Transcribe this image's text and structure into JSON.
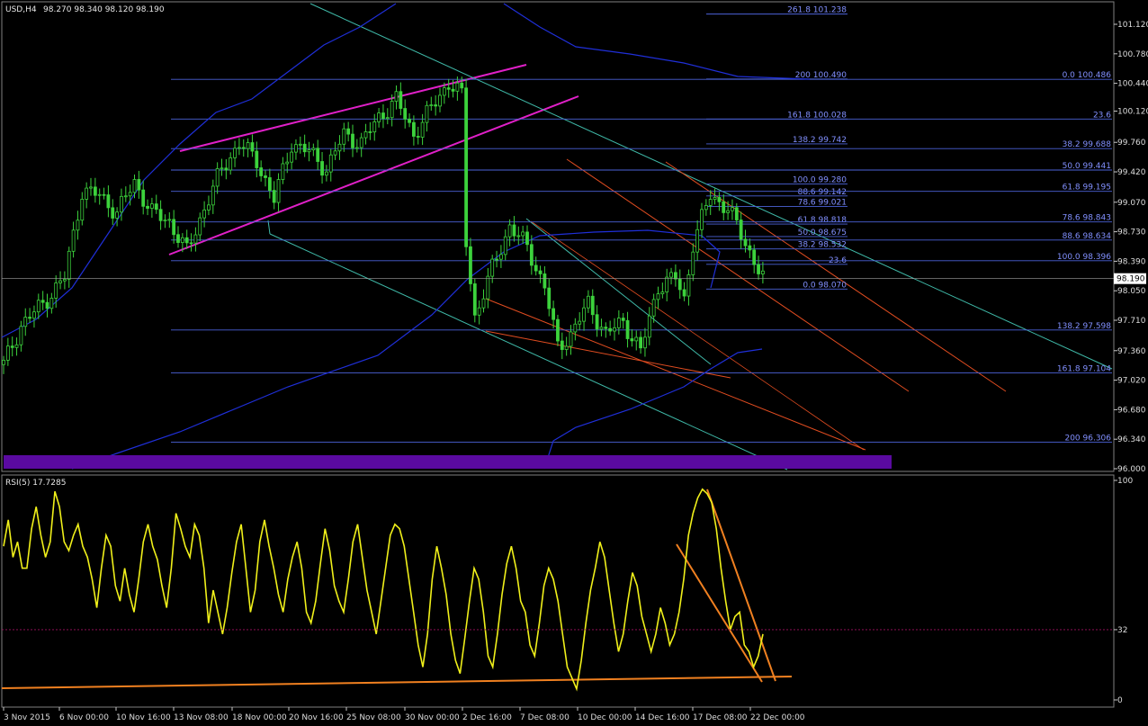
{
  "header": {
    "symbol_timeframe": "USD,H4",
    "ohlc": "98.270 98.340 98.120 98.190",
    "rsi_label": "RSI(5) 17.7285"
  },
  "chart_data": [
    {
      "type": "candlestick",
      "title": "USD,H4",
      "yticks": [
        "101.120",
        "100.780",
        "100.440",
        "100.120",
        "99.760",
        "99.420",
        "99.070",
        "98.730",
        "98.390",
        "98.050",
        "97.710",
        "97.360",
        "97.020",
        "96.680",
        "96.340",
        "96.000"
      ],
      "ylim": [
        96.0,
        101.12
      ],
      "current_price": "98.190",
      "xticks": [
        "3 Nov 2015",
        "6 Nov 00:00",
        "10 Nov 16:00",
        "13 Nov 08:00",
        "18 Nov 00:00",
        "20 Nov 16:00",
        "25 Nov 08:00",
        "30 Nov 00:00",
        "2 Dec 16:00",
        "7 Dec 08:00",
        "10 Dec 00:00",
        "14 Dec 16:00",
        "17 Dec 08:00",
        "22 Dec 00:00"
      ],
      "price_path": [
        {
          "bar": 0,
          "price": 97.2
        },
        {
          "bar": 4,
          "price": 97.65
        },
        {
          "bar": 9,
          "price": 97.9
        },
        {
          "bar": 14,
          "price": 98.2
        },
        {
          "bar": 18,
          "price": 99.2
        },
        {
          "bar": 22,
          "price": 99.15
        },
        {
          "bar": 26,
          "price": 98.95
        },
        {
          "bar": 30,
          "price": 99.3
        },
        {
          "bar": 34,
          "price": 98.95
        },
        {
          "bar": 38,
          "price": 98.85
        },
        {
          "bar": 42,
          "price": 98.5
        },
        {
          "bar": 46,
          "price": 99.0
        },
        {
          "bar": 50,
          "price": 99.45
        },
        {
          "bar": 54,
          "price": 99.75
        },
        {
          "bar": 58,
          "price": 99.55
        },
        {
          "bar": 62,
          "price": 99.1
        },
        {
          "bar": 66,
          "price": 99.75
        },
        {
          "bar": 70,
          "price": 99.65
        },
        {
          "bar": 74,
          "price": 99.45
        },
        {
          "bar": 78,
          "price": 99.85
        },
        {
          "bar": 82,
          "price": 99.75
        },
        {
          "bar": 86,
          "price": 100.05
        },
        {
          "bar": 90,
          "price": 100.25
        },
        {
          "bar": 94,
          "price": 99.85
        },
        {
          "bar": 98,
          "price": 100.15
        },
        {
          "bar": 102,
          "price": 100.45
        },
        {
          "bar": 105,
          "price": 100.3
        },
        {
          "bar": 106,
          "price": 98.6
        },
        {
          "bar": 108,
          "price": 97.75
        },
        {
          "bar": 112,
          "price": 98.3
        },
        {
          "bar": 116,
          "price": 98.8
        },
        {
          "bar": 120,
          "price": 98.55
        },
        {
          "bar": 124,
          "price": 98.1
        },
        {
          "bar": 127,
          "price": 97.4
        },
        {
          "bar": 130,
          "price": 97.55
        },
        {
          "bar": 134,
          "price": 97.9
        },
        {
          "bar": 138,
          "price": 97.55
        },
        {
          "bar": 142,
          "price": 97.7
        },
        {
          "bar": 146,
          "price": 97.35
        },
        {
          "bar": 150,
          "price": 98.1
        },
        {
          "bar": 154,
          "price": 98.2
        },
        {
          "bar": 156,
          "price": 97.95
        },
        {
          "bar": 158,
          "price": 98.6
        },
        {
          "bar": 162,
          "price": 99.15
        },
        {
          "bar": 166,
          "price": 99.0
        },
        {
          "bar": 170,
          "price": 98.6
        },
        {
          "bar": 174,
          "price": 98.2
        }
      ],
      "fibonacci_labels": [
        {
          "text": "261.8 101.238",
          "price": 101.238,
          "column": "left"
        },
        {
          "text": "200 100.490",
          "price": 100.49,
          "column": "left"
        },
        {
          "text": "161.8 100.028",
          "price": 100.028,
          "column": "left"
        },
        {
          "text": "138.2 99.742",
          "price": 99.742,
          "column": "left"
        },
        {
          "text": "100.0 99.280",
          "price": 99.28,
          "column": "left"
        },
        {
          "text": "88.6 99.142",
          "price": 99.142,
          "column": "left"
        },
        {
          "text": "78.6 99.021",
          "price": 99.021,
          "column": "left"
        },
        {
          "text": "61.8 98.818",
          "price": 98.818,
          "column": "left"
        },
        {
          "text": "50.0 98.675",
          "price": 98.675,
          "column": "left"
        },
        {
          "text": "38.2 98.532",
          "price": 98.532,
          "column": "left"
        },
        {
          "text": "23.6",
          "price": 98.355,
          "column": "left"
        },
        {
          "text": "0.0 98.070",
          "price": 98.07,
          "column": "left"
        },
        {
          "text": "0.0 100.486",
          "price": 100.486,
          "column": "right"
        },
        {
          "text": "23.6",
          "price": 100.028,
          "column": "right"
        },
        {
          "text": "38.2 99.688",
          "price": 99.688,
          "column": "right"
        },
        {
          "text": "50.0 99.441",
          "price": 99.441,
          "column": "right"
        },
        {
          "text": "61.8 99.195",
          "price": 99.195,
          "column": "right"
        },
        {
          "text": "78.6 98.843",
          "price": 98.843,
          "column": "right"
        },
        {
          "text": "88.6 98.634",
          "price": 98.634,
          "column": "right"
        },
        {
          "text": "100.0 98.396",
          "price": 98.396,
          "column": "right"
        },
        {
          "text": "138.2 97.598",
          "price": 97.598,
          "column": "right"
        },
        {
          "text": "161.8 97.104",
          "price": 97.104,
          "column": "right"
        },
        {
          "text": "200 96.306",
          "price": 96.306,
          "column": "right"
        }
      ]
    },
    {
      "type": "line",
      "title": "RSI(5) 17.7285",
      "yticks": [
        "100",
        "32",
        "0"
      ],
      "ylim": [
        0,
        100
      ],
      "level": 32,
      "values": [
        70,
        82,
        65,
        72,
        60,
        60,
        78,
        88,
        75,
        65,
        72,
        95,
        88,
        72,
        68,
        75,
        80,
        70,
        65,
        55,
        42,
        60,
        75,
        70,
        52,
        45,
        60,
        48,
        40,
        55,
        72,
        80,
        70,
        64,
        52,
        42,
        60,
        85,
        78,
        70,
        65,
        80,
        75,
        60,
        35,
        50,
        40,
        30,
        42,
        58,
        72,
        80,
        60,
        40,
        50,
        72,
        82,
        70,
        60,
        48,
        40,
        55,
        65,
        72,
        60,
        40,
        35,
        45,
        62,
        78,
        68,
        52,
        45,
        40,
        55,
        72,
        80,
        65,
        50,
        40,
        30,
        45,
        60,
        75,
        80,
        78,
        70,
        55,
        40,
        25,
        15,
        30,
        55,
        70,
        60,
        48,
        30,
        18,
        12,
        28,
        45,
        60,
        55,
        40,
        20,
        15,
        30,
        48,
        62,
        70,
        60,
        45,
        40,
        25,
        20,
        35,
        52,
        60,
        55,
        45,
        30,
        15,
        10,
        5,
        18,
        35,
        50,
        60,
        72,
        65,
        50,
        35,
        22,
        30,
        45,
        58,
        52,
        38,
        30,
        22,
        30,
        42,
        35,
        25,
        30,
        40,
        55,
        75,
        85,
        92,
        96,
        94,
        90,
        78,
        60,
        45,
        32,
        38,
        40,
        25,
        22,
        15,
        20,
        30
      ]
    }
  ]
}
